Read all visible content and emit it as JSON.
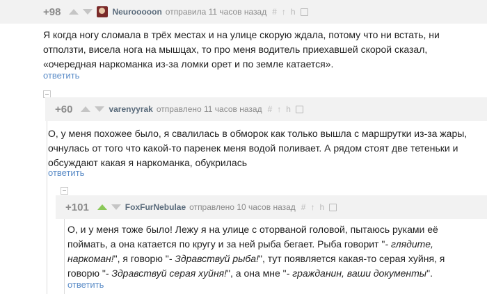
{
  "comments": [
    {
      "rating": "+98",
      "author": "Neurooooon",
      "time": "отправила 11 часов назад",
      "reply": "ответить",
      "tools": [
        "#",
        "↑",
        "h"
      ],
      "text": "Я когда ногу сломала в трёх местах и на улице скорую ждала, потому что ни встать, ни отползти, висела нога на мышцах, то про меня водитель приехавшей скорой сказал, «очередная наркоманка из-за ломки орет и по земле катается»."
    },
    {
      "rating": "+60",
      "author": "varenyyrak",
      "time": "отправлено 11 часов назад",
      "reply": "ответить",
      "tools": [
        "#",
        "↑",
        "h"
      ],
      "text": "О, у меня похожее было, я свалилась в обморок как только вышла с маршрутки из-за жары, очнулась от того что какой-то паренек меня водой поливает. А рядом стоят две тетеньки и обсуждают какая я наркоманка, обукрилась"
    },
    {
      "rating": "+101",
      "author": "FoxFurNebulae",
      "time": "отправлено 10 часов назад",
      "reply": "ответить",
      "tools": [
        "#",
        "↑",
        "h"
      ],
      "text_parts": {
        "p1": "О, и у меня тоже было! Лежу я на улице с оторваной головой, пытаюсь руками её поймать, а она катается по кругу и за ней рыба бегает. Рыба говорит \"",
        "q1": "- глядите, наркоман!",
        "p2": "\", я говорю \"",
        "q2": "- Здравствуй рыба!",
        "p3": "\", тут появляется какая-то серая хуйня, я говорю \"",
        "q3": "- Здравствуй серая хуйня!",
        "p4": "\", а она мне \"",
        "q4": "- гражданин, ваши документы",
        "p5": "\"."
      }
    }
  ],
  "colors": {
    "header_bg": "#f2f2f2",
    "rating": "#8b8b8b",
    "author": "#5a6b7b",
    "link": "#5b8cc7",
    "upvote_active": "#8ac858"
  }
}
